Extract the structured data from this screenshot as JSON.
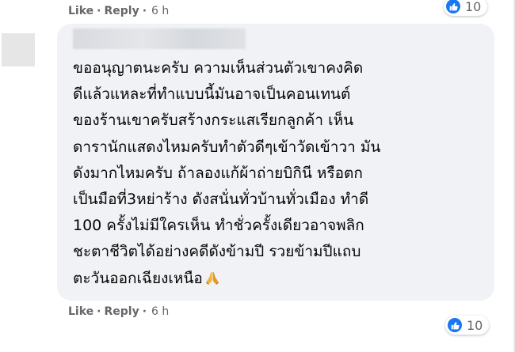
{
  "previous_comment": {
    "like_label": "Like",
    "separator": "·",
    "reply_label": "Reply",
    "time": "6 h",
    "reaction_count": "10"
  },
  "comment": {
    "lines": [
      "ขออนุญาตนะครับ ความเห็นส่วนตัวเขาคงคิด",
      "ดีแล้วแหละที่ทำแบบนี้มันอาจเป็นคอนเทนต์",
      "ของร้านเขาครับสร้างกระแสเรียกลูกค้า เห็น",
      "ดารานักแสดงไหมครับทำตัวดีๆเข้าวัดเข้าวา มัน",
      "ดังมากไหมครับ ถ้าลองแก้ผ้าถ่ายบิกินี หรือตก",
      "เป็นมือที่3หย่าร้าง ดังสนั่นทั่วบ้านทั่วเมือง ทำดี",
      "100 ครั้งไม่มีใครเห็น ทำชั่วครั้งเดียวอาจพลิก",
      "ชะตาชีวิตได้อย่างคดีดังข้ามปี รวยข้ามปีแถบ",
      "ตะวันออกเฉียงเหนือ"
    ],
    "emoji": "pray-emoji",
    "like_label": "Like",
    "separator": "·",
    "reply_label": "Reply",
    "time": "6 h",
    "reaction_count": "10"
  },
  "colors": {
    "bubble": "#f0f2f5",
    "meta_text": "#65676b",
    "like_blue": "#1877f2",
    "text": "#050505"
  }
}
